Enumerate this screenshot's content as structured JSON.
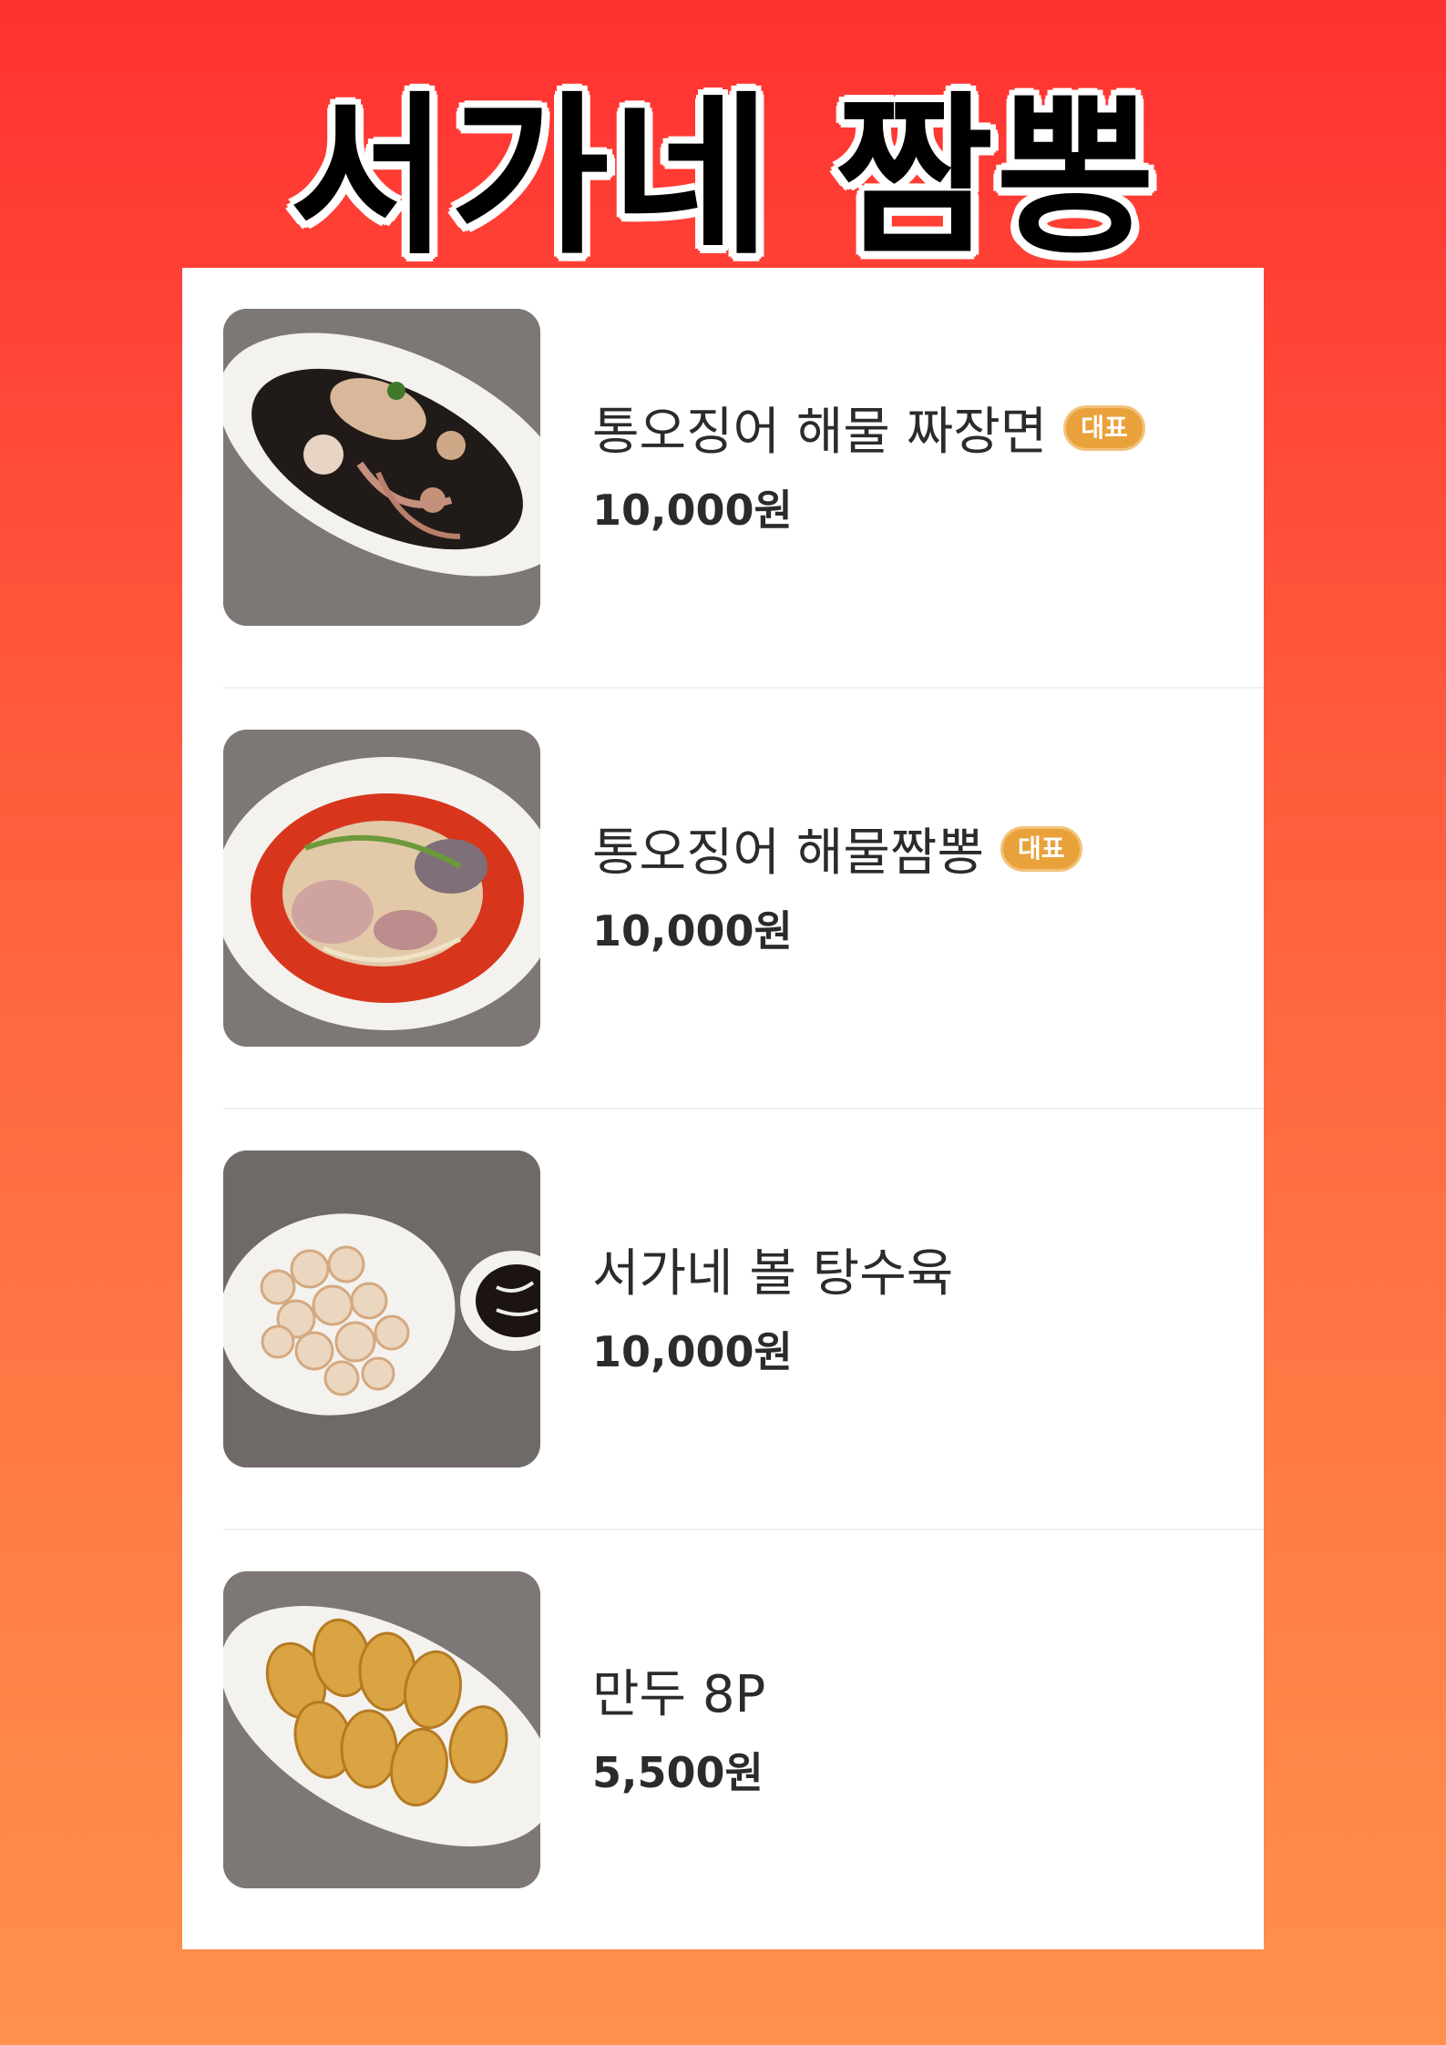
{
  "header": {
    "title": "서가네 짬뽕"
  },
  "menu": {
    "items": [
      {
        "name": "통오징어 해물 짜장면",
        "badge": "대표",
        "price": "10,000원",
        "image": "jajangmyeon-photo"
      },
      {
        "name": "통오징어 해물짬뽕",
        "badge": "대표",
        "price": "10,000원",
        "image": "jjamppong-photo"
      },
      {
        "name": "서가네 볼 탕수육",
        "badge": "",
        "price": "10,000원",
        "image": "tangsuyuk-photo"
      },
      {
        "name": "만두 8P",
        "badge": "",
        "price": "5,500원",
        "image": "mandu-photo"
      }
    ]
  },
  "colors": {
    "background_top": "#ff3131",
    "background_bottom": "#ff914d",
    "badge": "#e9a23b"
  }
}
